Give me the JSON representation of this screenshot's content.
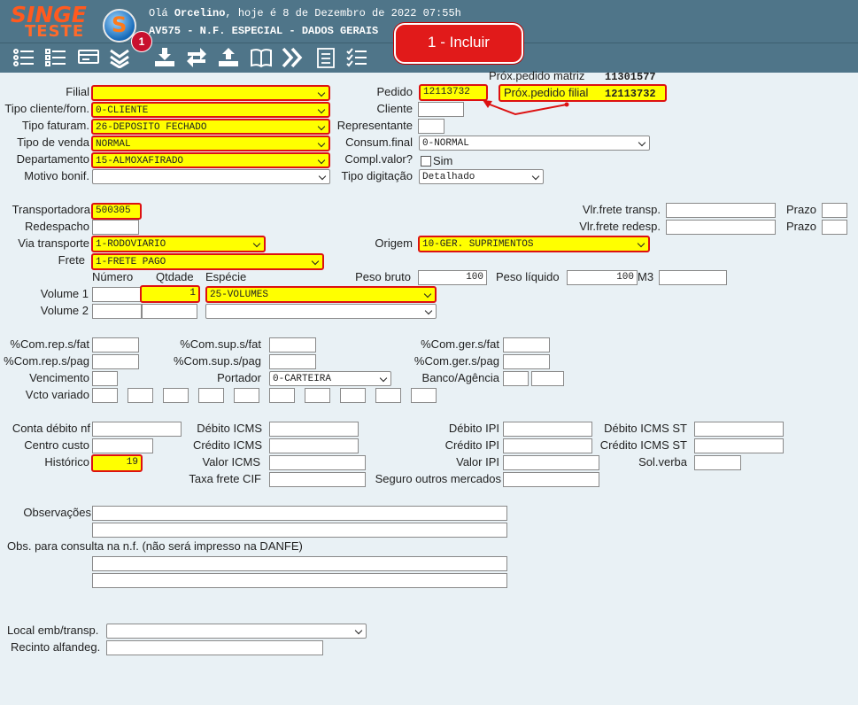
{
  "header": {
    "logo_top": "SINGE",
    "logo_bottom": "TESTE",
    "logo_mark": "S",
    "greeting_prefix": "Olá",
    "user": "Orcelino",
    "greeting_suffix": ", hoje é 8 de Dezembro de 2022 07:55h",
    "screen_title": "AV575 - N.F. ESPECIAL - DADOS GERAIS",
    "toolbar_icons": [
      "list-icon",
      "checklist-icon",
      "card-icon",
      "chevrons-down-icon",
      "download-icon",
      "refresh-icon",
      "upload-icon",
      "book-icon",
      "chevrons-right-icon",
      "report-icon",
      "tasklist-icon"
    ],
    "badge": "1",
    "callout": "1 - Incluir"
  },
  "form": {
    "prox_matriz_label": "Próx.pedido matriz",
    "prox_matriz_value": "11301577",
    "filial_label": "Filial",
    "filial_value": "",
    "pedido_label": "Pedido",
    "pedido_value": "12113732",
    "prox_filial_label": "Próx.pedido filial",
    "prox_filial_value": "12113732",
    "tipo_cliente_label": "Tipo cliente/forn.",
    "tipo_cliente_value": "0-CLIENTE",
    "cliente_label": "Cliente",
    "cliente_value": "",
    "tipo_faturam_label": "Tipo faturam.",
    "tipo_faturam_value": "26-DEPOSITO FECHADO",
    "representante_label": "Representante",
    "representante_value": "",
    "tipo_venda_label": "Tipo de venda",
    "tipo_venda_value": "NORMAL",
    "consum_final_label": "Consum.final",
    "consum_final_value": "0-NORMAL",
    "departamento_label": "Departamento",
    "departamento_value": "15-ALMOXAFIRADO",
    "compl_valor_label": "Compl.valor?",
    "compl_valor_option": "Sim",
    "motivo_bonif_label": "Motivo bonif.",
    "motivo_bonif_value": "",
    "tipo_digitacao_label": "Tipo digitação",
    "tipo_digitacao_value": "Detalhado",
    "transportadora_label": "Transportadora",
    "transportadora_value": "500305",
    "vlr_frete_transp_label": "Vlr.frete transp.",
    "prazo_label": "Prazo",
    "redespacho_label": "Redespacho",
    "vlr_frete_redesp_label": "Vlr.frete redesp.",
    "via_transporte_label": "Via transporte",
    "via_transporte_value": "1-RODOVIARIO",
    "origem_label": "Origem",
    "origem_value": "10-GER. SUPRIMENTOS",
    "frete_label": "Frete",
    "frete_value": "1-FRETE PAGO",
    "numero_label": "Número",
    "qtdade_label": "Qtdade",
    "especie_label": "Espécie",
    "peso_bruto_label": "Peso bruto",
    "peso_bruto_value": "100",
    "peso_liquido_label": "Peso líquido",
    "peso_liquido_value": "100",
    "m3_label": "M3",
    "volume1_label": "Volume 1",
    "volume1_qtd": "1",
    "volume1_especie": "25-VOLUMES",
    "volume2_label": "Volume 2",
    "com_rep_fat_label": "%Com.rep.s/fat",
    "com_sup_fat_label": "%Com.sup.s/fat",
    "com_ger_fat_label": "%Com.ger.s/fat",
    "com_rep_pag_label": "%Com.rep.s/pag",
    "com_sup_pag_label": "%Com.sup.s/pag",
    "com_ger_pag_label": "%Com.ger.s/pag",
    "vencimento_label": "Vencimento",
    "portador_label": "Portador",
    "portador_value": "0-CARTEIRA",
    "banco_agencia_label": "Banco/Agência",
    "vcto_variado_label": "Vcto variado",
    "conta_debito_label": "Conta débito nf",
    "debito_icms_label": "Débito ICMS",
    "debito_ipi_label": "Débito IPI",
    "debito_icms_st_label": "Débito ICMS ST",
    "centro_custo_label": "Centro custo",
    "credito_icms_label": "Crédito ICMS",
    "credito_ipi_label": "Crédito IPI",
    "credito_icms_st_label": "Crédito ICMS ST",
    "historico_label": "Histórico",
    "historico_value": "19",
    "valor_icms_label": "Valor ICMS",
    "valor_ipi_label": "Valor IPI",
    "sol_verba_label": "Sol.verba",
    "taxa_frete_label": "Taxa frete CIF",
    "seguro_label": "Seguro outros mercados",
    "observacoes_label": "Observações",
    "obs_consulta_label": "Obs. para consulta na n.f. (não será impresso na DANFE)",
    "local_emb_label": "Local emb/transp.",
    "recinto_label": "Recinto alfandeg."
  },
  "colors": {
    "header_bg": "#4f7589",
    "page_bg": "#e9f1f5",
    "highlight": "#ffff00",
    "annotation_red": "#dd1111"
  }
}
